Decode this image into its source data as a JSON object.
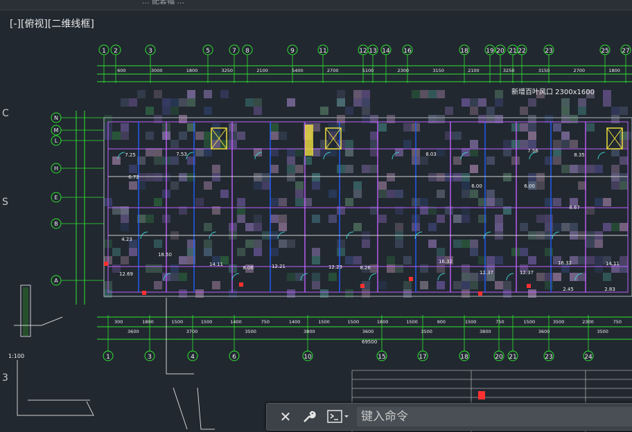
{
  "window": {
    "title_fragment": "... 配套幅 ..."
  },
  "viewport": {
    "label": "[-][俯视][二维线框]"
  },
  "edge_letters": [
    "C",
    "S",
    "3"
  ],
  "scale_label": "1:100",
  "grid_top": [
    "1",
    "2",
    "3",
    "5",
    "7",
    "8",
    "9",
    "11",
    "12",
    "13",
    "14",
    "16",
    "18",
    "19",
    "20",
    "21",
    "22",
    "23",
    "25",
    "27"
  ],
  "grid_bottom": [
    "1",
    "3",
    "4",
    "6",
    "10",
    "15",
    "17",
    "18",
    "20",
    "21",
    "23",
    "24"
  ],
  "grid_left": [
    "N",
    "M",
    "L",
    "H",
    "E",
    "B",
    "A"
  ],
  "dims_top_row1": [
    "600",
    "3000",
    "1800",
    "3250",
    "2100",
    "5400",
    "2700",
    "5100",
    "2300",
    "3150",
    "2100",
    "3250",
    "3150",
    "2700",
    "1800"
  ],
  "dims_bottom_row1": [
    "300",
    "1800",
    "1500",
    "1500",
    "1400",
    "750",
    "1400",
    "1500",
    "1500",
    "1800",
    "1500",
    "900",
    "1500",
    "750",
    "1500",
    "3500",
    "2300",
    "750"
  ],
  "dims_bottom_row2": [
    "3600",
    "3700",
    "3500",
    "3800",
    "3600",
    "3500",
    "3800",
    "3600",
    "3500"
  ],
  "total_width": "69500",
  "annotation": "新增百叶风口 2300x1600",
  "room_areas": [
    "7.25",
    "7.53",
    "6.72",
    "4.23",
    "12.69",
    "18.50",
    "14.11",
    "8.06",
    "12.21",
    "12.23",
    "8.26",
    "16.32",
    "12.37",
    "12.37",
    "8.67",
    "16.32",
    "14.11",
    "6.00",
    "6.00",
    "7.56",
    "8.35",
    "8.03",
    "2.45",
    "2.83"
  ],
  "command_line": {
    "placeholder": "键入命令",
    "close_icon": "close-icon",
    "settings_icon": "wrench-icon",
    "prompt_icon": "command-prompt-icon"
  },
  "colors": {
    "background": "#212830",
    "grid": "#2fe62f",
    "walls": "#c060ff",
    "blue": "#2060ff",
    "yellow": "#f0e040",
    "text": "#f2f2f2",
    "cyan": "#40d0d0",
    "red": "#ff3030"
  }
}
